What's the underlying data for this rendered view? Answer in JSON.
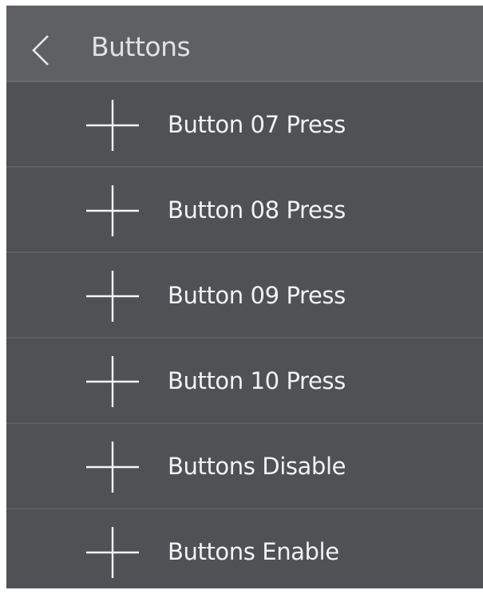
{
  "header": {
    "title": "Buttons",
    "back_icon": "chevron-left-icon"
  },
  "list": {
    "items": [
      {
        "label": "Button 07 Press",
        "icon": "plus-icon"
      },
      {
        "label": "Button 08 Press",
        "icon": "plus-icon"
      },
      {
        "label": "Button 09 Press",
        "icon": "plus-icon"
      },
      {
        "label": "Button 10 Press",
        "icon": "plus-icon"
      },
      {
        "label": "Buttons Disable",
        "icon": "plus-icon"
      },
      {
        "label": "Buttons Enable",
        "icon": "plus-icon"
      }
    ]
  },
  "colors": {
    "background": "#4f5154",
    "header_background": "#5e6063",
    "separator": "#5d5f62",
    "text": "#f2f2f2"
  }
}
